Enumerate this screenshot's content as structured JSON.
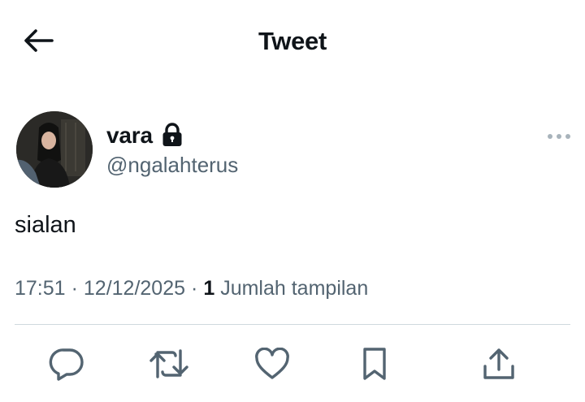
{
  "header": {
    "title": "Tweet",
    "back_icon": "arrow-left-icon"
  },
  "author": {
    "display_name": "vara",
    "username": "@ngalahterus",
    "protected_icon": "lock-icon"
  },
  "tweet": {
    "text": "sialan"
  },
  "meta": {
    "time": "17:51",
    "separator": "·",
    "date": "12/12/2025",
    "views_count": "1",
    "views_label": "Jumlah tampilan"
  },
  "actions": {
    "icons": [
      "reply-icon",
      "retweet-icon",
      "like-icon",
      "bookmark-icon",
      "share-icon"
    ]
  },
  "colors": {
    "text": "#0f1419",
    "secondary": "#536471",
    "divider": "#cfd9de"
  }
}
